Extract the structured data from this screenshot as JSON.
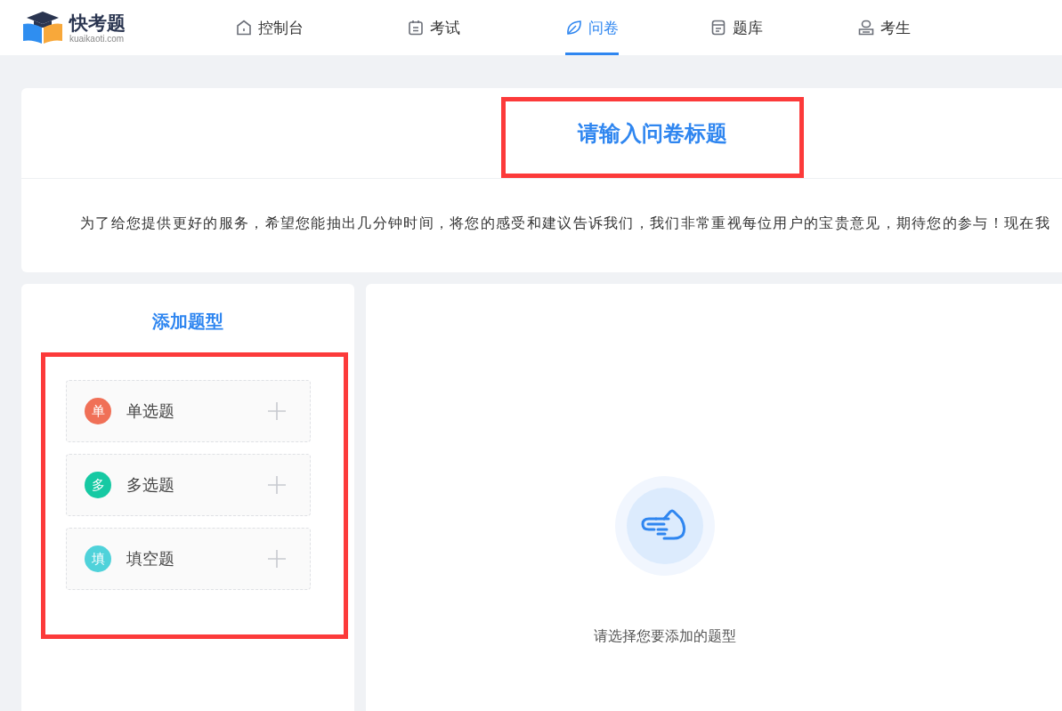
{
  "logo": {
    "name": "快考题",
    "domain": "kuaikaoti.com"
  },
  "nav": [
    {
      "label": "控制台",
      "selected": false
    },
    {
      "label": "考试",
      "selected": false
    },
    {
      "label": "问卷",
      "selected": true
    },
    {
      "label": "题库",
      "selected": false
    },
    {
      "label": "考生",
      "selected": false
    }
  ],
  "survey": {
    "title": "请输入问卷标题",
    "description": "为了给您提供更好的服务，希望您能抽出几分钟时间，将您的感受和建议告诉我们，我们非常重视每位用户的宝贵意见，期待您的参与！现在我"
  },
  "add_panel": {
    "heading": "添加题型",
    "types": [
      {
        "badge": "单",
        "label": "单选题",
        "color": "#f07057"
      },
      {
        "badge": "多",
        "label": "多选题",
        "color": "#16c9a3"
      },
      {
        "badge": "填",
        "label": "填空题",
        "color": "#4fd2da"
      }
    ]
  },
  "empty_state": {
    "message": "请选择您要添加的题型"
  }
}
